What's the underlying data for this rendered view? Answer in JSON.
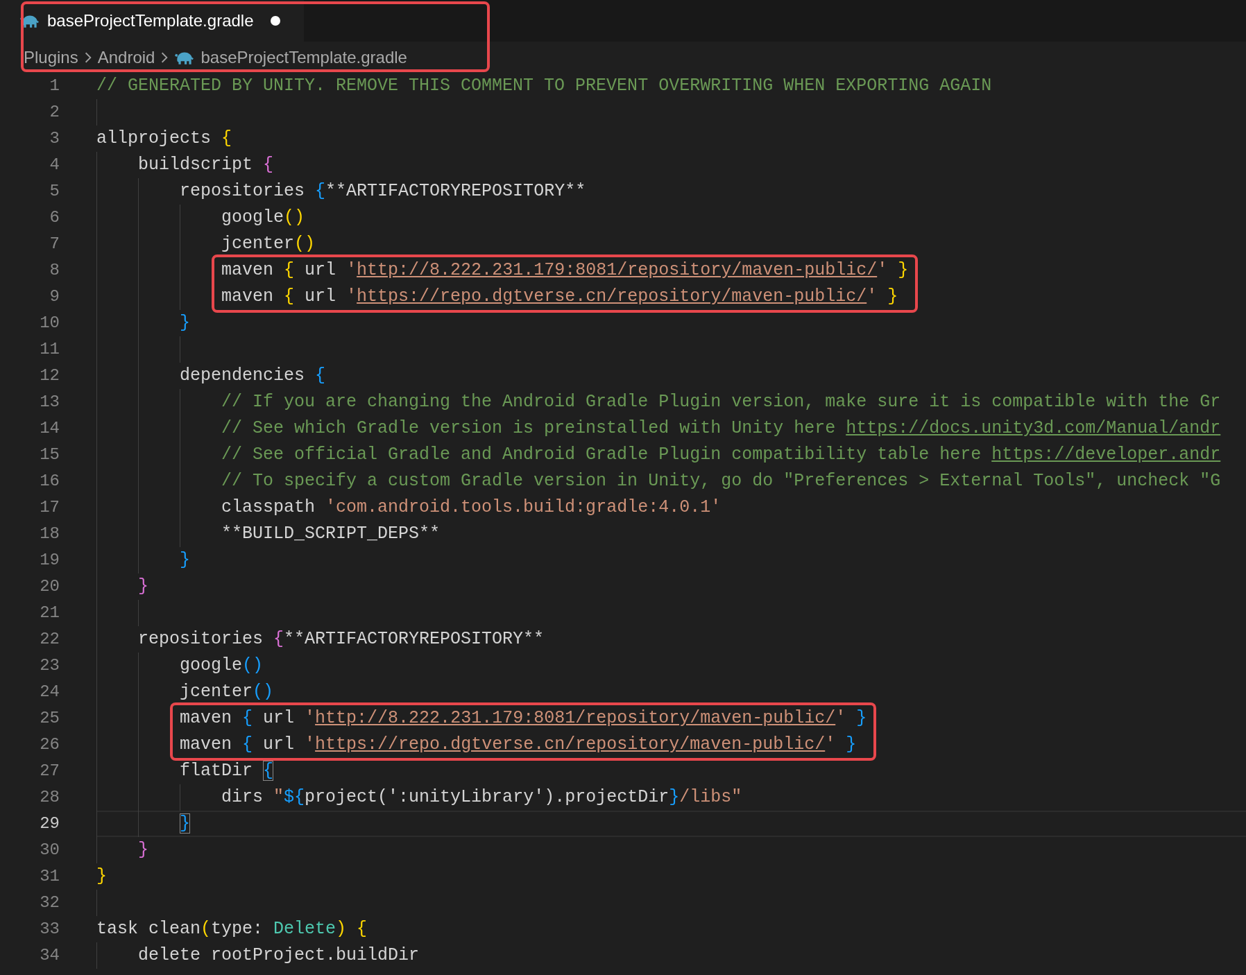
{
  "tab": {
    "title": "baseProjectTemplate.gradle",
    "modified": true,
    "selected": true
  },
  "breadcrumb": {
    "boxed": true,
    "items": [
      {
        "label": "Plugins",
        "kind": "folder"
      },
      {
        "label": "Android",
        "kind": "folder"
      },
      {
        "label": "baseProjectTemplate.gradle",
        "kind": "file"
      }
    ]
  },
  "lines": [
    {
      "number": "1",
      "current": false,
      "tokens": [
        {
          "kind": "comment",
          "text": "// GENERATED BY UNITY. REMOVE THIS COMMENT TO PREVENT OVERWRITING WHEN EXPORTING AGAIN"
        }
      ]
    },
    {
      "number": "2",
      "current": false
    },
    {
      "number": "3",
      "current": false,
      "tokens": [
        {
          "kind": "plain",
          "text": "allprojects "
        },
        {
          "kind": "bracket1",
          "text": "{"
        }
      ]
    },
    {
      "number": "4",
      "current": false,
      "tokens": [
        {
          "kind": "plain",
          "text": "    buildscript "
        },
        {
          "kind": "bracket2",
          "text": "{"
        }
      ]
    },
    {
      "number": "5",
      "current": false,
      "tokens": [
        {
          "kind": "plain",
          "text": "        repositories "
        },
        {
          "kind": "bracket3",
          "text": "{"
        },
        {
          "kind": "plain",
          "text": "**ARTIFACTORYREPOSITORY**"
        }
      ]
    },
    {
      "number": "6",
      "current": false,
      "tokens": [
        {
          "kind": "plain",
          "text": "            google"
        },
        {
          "kind": "bracket1",
          "text": "()"
        }
      ]
    },
    {
      "number": "7",
      "current": false,
      "tokens": [
        {
          "kind": "plain",
          "text": "            jcenter"
        },
        {
          "kind": "bracket1",
          "text": "()"
        }
      ]
    },
    {
      "number": "8",
      "current": false,
      "boxed": true,
      "tokens": [
        {
          "kind": "plain",
          "text": "            maven "
        },
        {
          "kind": "bracket1",
          "text": "{"
        },
        {
          "kind": "plain",
          "text": " url "
        },
        {
          "kind": "string",
          "text": "'"
        },
        {
          "kind": "link",
          "text": "http://8.222.231.179:8081/repository/maven-public/"
        },
        {
          "kind": "string",
          "text": "'"
        },
        {
          "kind": "bracket1",
          "text": " }"
        }
      ]
    },
    {
      "number": "9",
      "current": false,
      "boxed": true,
      "tokens": [
        {
          "kind": "plain",
          "text": "            maven "
        },
        {
          "kind": "bracket1",
          "text": "{"
        },
        {
          "kind": "plain",
          "text": " url "
        },
        {
          "kind": "string",
          "text": "'"
        },
        {
          "kind": "link",
          "text": "https://repo.dgtverse.cn/repository/maven-public/"
        },
        {
          "kind": "string",
          "text": "'"
        },
        {
          "kind": "bracket1",
          "text": " }"
        }
      ]
    },
    {
      "number": "10",
      "current": false,
      "tokens": [
        {
          "kind": "bracket3",
          "text": "        }"
        }
      ]
    },
    {
      "number": "11",
      "current": false
    },
    {
      "number": "12",
      "current": false,
      "tokens": [
        {
          "kind": "plain",
          "text": "        dependencies "
        },
        {
          "kind": "bracket3",
          "text": "{"
        }
      ]
    },
    {
      "number": "13",
      "current": false,
      "tokens": [
        {
          "kind": "comment",
          "text": "            // If you are changing the Android Gradle Plugin version, make sure it is compatible with the Gr"
        }
      ]
    },
    {
      "number": "14",
      "current": false,
      "tokens": [
        {
          "kind": "comment",
          "text": "            // See which Gradle version is preinstalled with Unity here "
        },
        {
          "kind": "commentlink",
          "text": "https://docs.unity3d.com/Manual/andr"
        }
      ]
    },
    {
      "number": "15",
      "current": false,
      "tokens": [
        {
          "kind": "comment",
          "text": "            // See official Gradle and Android Gradle Plugin compatibility table here "
        },
        {
          "kind": "commentlink",
          "text": "https://developer.andr"
        }
      ]
    },
    {
      "number": "16",
      "current": false,
      "tokens": [
        {
          "kind": "comment",
          "text": "            // To specify a custom Gradle version in Unity, go do \"Preferences > External Tools\", uncheck \"G"
        }
      ]
    },
    {
      "number": "17",
      "current": false,
      "tokens": [
        {
          "kind": "plain",
          "text": "            classpath "
        },
        {
          "kind": "string",
          "text": "'com.android.tools.build:gradle:4.0.1'"
        }
      ]
    },
    {
      "number": "18",
      "current": false,
      "tokens": [
        {
          "kind": "plain",
          "text": "            **BUILD_SCRIPT_DEPS**"
        }
      ]
    },
    {
      "number": "19",
      "current": false,
      "tokens": [
        {
          "kind": "bracket3",
          "text": "        }"
        }
      ]
    },
    {
      "number": "20",
      "current": false,
      "tokens": [
        {
          "kind": "bracket2",
          "text": "    }"
        }
      ]
    },
    {
      "number": "21",
      "current": false
    },
    {
      "number": "22",
      "current": false,
      "tokens": [
        {
          "kind": "plain",
          "text": "    repositories "
        },
        {
          "kind": "bracket2",
          "text": "{"
        },
        {
          "kind": "plain",
          "text": "**ARTIFACTORYREPOSITORY**"
        }
      ]
    },
    {
      "number": "23",
      "current": false,
      "tokens": [
        {
          "kind": "plain",
          "text": "        google"
        },
        {
          "kind": "bracket3",
          "text": "()"
        }
      ]
    },
    {
      "number": "24",
      "current": false,
      "tokens": [
        {
          "kind": "plain",
          "text": "        jcenter"
        },
        {
          "kind": "bracket3",
          "text": "()"
        }
      ]
    },
    {
      "number": "25",
      "current": false,
      "boxed": true,
      "tokens": [
        {
          "kind": "plain",
          "text": "        maven "
        },
        {
          "kind": "bracket3",
          "text": "{"
        },
        {
          "kind": "plain",
          "text": " url "
        },
        {
          "kind": "string",
          "text": "'"
        },
        {
          "kind": "link",
          "text": "http://8.222.231.179:8081/repository/maven-public/"
        },
        {
          "kind": "string",
          "text": "'"
        },
        {
          "kind": "bracket3",
          "text": " }"
        }
      ]
    },
    {
      "number": "26",
      "current": false,
      "boxed": true,
      "tokens": [
        {
          "kind": "plain",
          "text": "        maven "
        },
        {
          "kind": "bracket3",
          "text": "{"
        },
        {
          "kind": "plain",
          "text": " url "
        },
        {
          "kind": "string",
          "text": "'"
        },
        {
          "kind": "link",
          "text": "https://repo.dgtverse.cn/repository/maven-public/"
        },
        {
          "kind": "string",
          "text": "'"
        },
        {
          "kind": "bracket3",
          "text": " }"
        }
      ]
    },
    {
      "number": "27",
      "current": false,
      "tokens": [
        {
          "kind": "plain",
          "text": "        flatDir "
        },
        {
          "kind": "bracket3",
          "text": "{",
          "matched": true
        }
      ]
    },
    {
      "number": "28",
      "current": false,
      "tokens": [
        {
          "kind": "plain",
          "text": "            dirs "
        },
        {
          "kind": "string",
          "text": "\""
        },
        {
          "kind": "bracket3",
          "text": "${"
        },
        {
          "kind": "plain",
          "text": "project(':unityLibrary').projectDir"
        },
        {
          "kind": "bracket3",
          "text": "}"
        },
        {
          "kind": "string",
          "text": "/libs\""
        }
      ]
    },
    {
      "number": "29",
      "current": true,
      "tokens": [
        {
          "kind": "bracket3",
          "text": "        }",
          "matched": true
        }
      ]
    },
    {
      "number": "30",
      "current": false,
      "tokens": [
        {
          "kind": "bracket2",
          "text": "    }"
        }
      ]
    },
    {
      "number": "31",
      "current": false,
      "tokens": [
        {
          "kind": "bracket1",
          "text": "}"
        }
      ]
    },
    {
      "number": "32",
      "current": false
    },
    {
      "number": "33",
      "current": false,
      "tokens": [
        {
          "kind": "plain",
          "text": "task clean"
        },
        {
          "kind": "bracket1",
          "text": "("
        },
        {
          "kind": "plain",
          "text": "type: "
        },
        {
          "kind": "type",
          "text": "Delete"
        },
        {
          "kind": "bracket1",
          "text": ") {"
        }
      ]
    },
    {
      "number": "34",
      "current": false,
      "tokens": [
        {
          "kind": "plain",
          "text": "    delete rootProject.buildDir"
        }
      ]
    }
  ]
}
